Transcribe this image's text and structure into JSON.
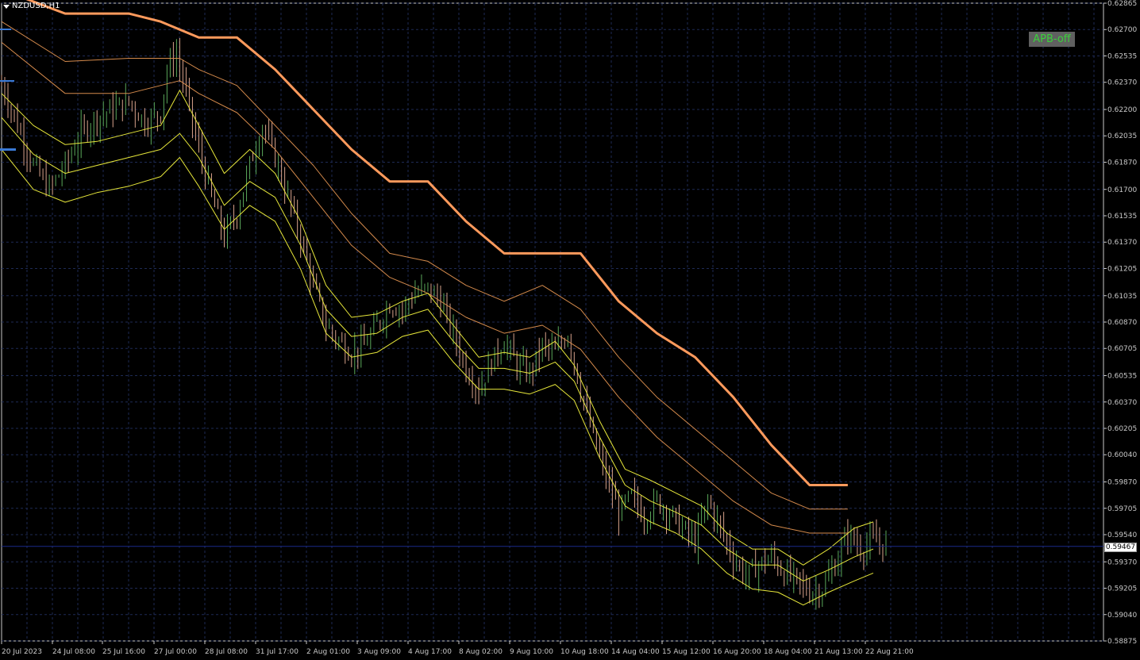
{
  "chart": {
    "symbol": "NZDUSD,H1",
    "button_label": "APB-off",
    "current_price": "0.59467"
  },
  "colors": {
    "background": "#000000",
    "grid": "#1e2a55",
    "axis": "#c8c8c8",
    "bull": "#5aa85a",
    "bear": "#d9a38c",
    "band_thick": "#ff9a5c",
    "band_thin": "#d48a4c",
    "ma_yellow": "#e6e63a",
    "bid_line": "#1a2a8a",
    "button_text": "#3ad13a"
  },
  "chart_data": {
    "type": "line",
    "title": "NZDUSD,H1",
    "ylim": [
      0.58875,
      0.62865
    ],
    "y_ticks": [
      "0.62865",
      "0.62700",
      "0.62535",
      "0.62370",
      "0.62200",
      "0.62035",
      "0.61870",
      "0.61700",
      "0.61535",
      "0.61370",
      "0.61205",
      "0.61035",
      "0.60870",
      "0.60705",
      "0.60535",
      "0.60370",
      "0.60205",
      "0.60040",
      "0.59870",
      "0.59705",
      "0.59540",
      "0.59370",
      "0.59205",
      "0.59040",
      "0.58875"
    ],
    "x_ticks": [
      "20 Jul 2023",
      "24 Jul 08:00",
      "25 Jul 16:00",
      "27 Jul 00:00",
      "28 Jul 08:00",
      "31 Jul 17:00",
      "2 Aug 01:00",
      "3 Aug 09:00",
      "4 Aug 17:00",
      "8 Aug 02:00",
      "9 Aug 10:00",
      "10 Aug 18:00",
      "14 Aug 04:00",
      "15 Aug 12:00",
      "16 Aug 20:00",
      "18 Aug 04:00",
      "21 Aug 13:00",
      "22 Aug 21:00"
    ],
    "grid": true,
    "price_close": [
      [
        0,
        0.6236
      ],
      [
        5,
        0.621
      ],
      [
        10,
        0.6185
      ],
      [
        15,
        0.617
      ],
      [
        20,
        0.6185
      ],
      [
        25,
        0.6205
      ],
      [
        30,
        0.6215
      ],
      [
        35,
        0.622
      ],
      [
        40,
        0.6225
      ],
      [
        45,
        0.6212
      ],
      [
        50,
        0.6218
      ],
      [
        52,
        0.6245
      ],
      [
        55,
        0.6255
      ],
      [
        58,
        0.623
      ],
      [
        62,
        0.6195
      ],
      [
        66,
        0.6165
      ],
      [
        70,
        0.614
      ],
      [
        74,
        0.6155
      ],
      [
        78,
        0.6185
      ],
      [
        82,
        0.621
      ],
      [
        86,
        0.619
      ],
      [
        90,
        0.6165
      ],
      [
        94,
        0.614
      ],
      [
        98,
        0.611
      ],
      [
        102,
        0.6085
      ],
      [
        106,
        0.6075
      ],
      [
        110,
        0.6068
      ],
      [
        114,
        0.6072
      ],
      [
        118,
        0.6085
      ],
      [
        122,
        0.6098
      ],
      [
        126,
        0.6095
      ],
      [
        130,
        0.6105
      ],
      [
        134,
        0.6108
      ],
      [
        138,
        0.61
      ],
      [
        142,
        0.608
      ],
      [
        146,
        0.6058
      ],
      [
        150,
        0.6045
      ],
      [
        154,
        0.6062
      ],
      [
        158,
        0.6075
      ],
      [
        162,
        0.606
      ],
      [
        166,
        0.6055
      ],
      [
        170,
        0.6072
      ],
      [
        174,
        0.6068
      ],
      [
        178,
        0.608
      ],
      [
        182,
        0.6045
      ],
      [
        186,
        0.6015
      ],
      [
        190,
        0.599
      ],
      [
        194,
        0.5968
      ],
      [
        198,
        0.5978
      ],
      [
        202,
        0.5965
      ],
      [
        206,
        0.5975
      ],
      [
        210,
        0.5968
      ],
      [
        214,
        0.5958
      ],
      [
        218,
        0.595
      ],
      [
        222,
        0.5975
      ],
      [
        226,
        0.5958
      ],
      [
        230,
        0.594
      ],
      [
        234,
        0.5928
      ],
      [
        238,
        0.5935
      ],
      [
        242,
        0.594
      ],
      [
        246,
        0.593
      ],
      [
        250,
        0.5925
      ],
      [
        254,
        0.5918
      ],
      [
        258,
        0.592
      ],
      [
        262,
        0.5935
      ],
      [
        266,
        0.5955
      ],
      [
        270,
        0.5945
      ],
      [
        274,
        0.595
      ],
      [
        278,
        0.5947
      ]
    ],
    "series": [
      {
        "name": "",
        "values": [
          [
            0,
            0.6295
          ],
          [
            20,
            0.628
          ],
          [
            40,
            0.628
          ],
          [
            50,
            0.6275
          ],
          [
            56,
            0.627
          ],
          [
            62,
            0.6265
          ],
          [
            74,
            0.6265
          ],
          [
            86,
            0.6245
          ],
          [
            98,
            0.622
          ],
          [
            110,
            0.6195
          ],
          [
            122,
            0.6175
          ],
          [
            134,
            0.6175
          ],
          [
            146,
            0.615
          ],
          [
            158,
            0.613
          ],
          [
            170,
            0.613
          ],
          [
            182,
            0.613
          ],
          [
            194,
            0.61
          ],
          [
            206,
            0.608
          ],
          [
            218,
            0.6065
          ],
          [
            230,
            0.604
          ],
          [
            242,
            0.601
          ],
          [
            254,
            0.5985
          ],
          [
            266,
            0.5985
          ]
        ]
      },
      {
        "name": "",
        "values": [
          [
            0,
            0.6275
          ],
          [
            20,
            0.625
          ],
          [
            40,
            0.6252
          ],
          [
            56,
            0.6252
          ],
          [
            62,
            0.6245
          ],
          [
            74,
            0.6235
          ],
          [
            86,
            0.621
          ],
          [
            98,
            0.6185
          ],
          [
            110,
            0.6155
          ],
          [
            122,
            0.613
          ],
          [
            134,
            0.6125
          ],
          [
            146,
            0.611
          ],
          [
            158,
            0.61
          ],
          [
            170,
            0.611
          ],
          [
            182,
            0.6095
          ],
          [
            194,
            0.6065
          ],
          [
            206,
            0.604
          ],
          [
            218,
            0.602
          ],
          [
            230,
            0.6
          ],
          [
            242,
            0.598
          ],
          [
            254,
            0.597
          ],
          [
            266,
            0.597
          ]
        ]
      },
      {
        "name": "",
        "values": [
          [
            0,
            0.6262
          ],
          [
            20,
            0.623
          ],
          [
            40,
            0.623
          ],
          [
            56,
            0.6238
          ],
          [
            62,
            0.623
          ],
          [
            74,
            0.6218
          ],
          [
            86,
            0.6195
          ],
          [
            98,
            0.6165
          ],
          [
            110,
            0.6135
          ],
          [
            122,
            0.6115
          ],
          [
            134,
            0.6105
          ],
          [
            146,
            0.609
          ],
          [
            158,
            0.608
          ],
          [
            170,
            0.6085
          ],
          [
            182,
            0.607
          ],
          [
            194,
            0.604
          ],
          [
            206,
            0.6015
          ],
          [
            218,
            0.5995
          ],
          [
            230,
            0.5975
          ],
          [
            242,
            0.596
          ],
          [
            254,
            0.5955
          ],
          [
            266,
            0.5955
          ]
        ]
      },
      {
        "name": "",
        "values": [
          [
            0,
            0.623
          ],
          [
            10,
            0.621
          ],
          [
            20,
            0.6198
          ],
          [
            30,
            0.62
          ],
          [
            40,
            0.6205
          ],
          [
            50,
            0.621
          ],
          [
            56,
            0.6232
          ],
          [
            62,
            0.621
          ],
          [
            70,
            0.618
          ],
          [
            78,
            0.6195
          ],
          [
            86,
            0.618
          ],
          [
            94,
            0.615
          ],
          [
            102,
            0.611
          ],
          [
            110,
            0.609
          ],
          [
            118,
            0.6092
          ],
          [
            126,
            0.61
          ],
          [
            134,
            0.6105
          ],
          [
            142,
            0.6085
          ],
          [
            150,
            0.6065
          ],
          [
            158,
            0.6068
          ],
          [
            166,
            0.6065
          ],
          [
            174,
            0.6075
          ],
          [
            180,
            0.606
          ],
          [
            188,
            0.6025
          ],
          [
            196,
            0.5995
          ],
          [
            204,
            0.5988
          ],
          [
            212,
            0.598
          ],
          [
            220,
            0.5972
          ],
          [
            228,
            0.5955
          ],
          [
            236,
            0.5945
          ],
          [
            244,
            0.5945
          ],
          [
            252,
            0.5935
          ],
          [
            260,
            0.5945
          ],
          [
            268,
            0.5958
          ],
          [
            274,
            0.5962
          ]
        ]
      },
      {
        "name": "",
        "values": [
          [
            0,
            0.6215
          ],
          [
            10,
            0.6192
          ],
          [
            20,
            0.618
          ],
          [
            30,
            0.6185
          ],
          [
            40,
            0.619
          ],
          [
            50,
            0.6195
          ],
          [
            56,
            0.6205
          ],
          [
            62,
            0.619
          ],
          [
            70,
            0.616
          ],
          [
            78,
            0.6175
          ],
          [
            86,
            0.6165
          ],
          [
            94,
            0.6135
          ],
          [
            102,
            0.6095
          ],
          [
            110,
            0.6078
          ],
          [
            118,
            0.608
          ],
          [
            126,
            0.609
          ],
          [
            134,
            0.6095
          ],
          [
            142,
            0.6075
          ],
          [
            150,
            0.6058
          ],
          [
            158,
            0.6058
          ],
          [
            166,
            0.6055
          ],
          [
            174,
            0.6062
          ],
          [
            180,
            0.605
          ],
          [
            188,
            0.6015
          ],
          [
            196,
            0.5985
          ],
          [
            204,
            0.5975
          ],
          [
            212,
            0.5968
          ],
          [
            220,
            0.596
          ],
          [
            228,
            0.5945
          ],
          [
            236,
            0.5935
          ],
          [
            244,
            0.5935
          ],
          [
            252,
            0.5925
          ],
          [
            260,
            0.5932
          ],
          [
            268,
            0.594
          ],
          [
            274,
            0.5945
          ]
        ]
      },
      {
        "name": "",
        "values": [
          [
            0,
            0.6195
          ],
          [
            10,
            0.617
          ],
          [
            20,
            0.6162
          ],
          [
            30,
            0.6168
          ],
          [
            40,
            0.6172
          ],
          [
            50,
            0.6178
          ],
          [
            56,
            0.619
          ],
          [
            62,
            0.6172
          ],
          [
            70,
            0.6145
          ],
          [
            78,
            0.616
          ],
          [
            86,
            0.615
          ],
          [
            94,
            0.612
          ],
          [
            102,
            0.608
          ],
          [
            110,
            0.6065
          ],
          [
            118,
            0.6068
          ],
          [
            126,
            0.6078
          ],
          [
            134,
            0.6082
          ],
          [
            142,
            0.6062
          ],
          [
            150,
            0.6045
          ],
          [
            158,
            0.6045
          ],
          [
            166,
            0.6042
          ],
          [
            174,
            0.6048
          ],
          [
            180,
            0.6038
          ],
          [
            188,
            0.6002
          ],
          [
            196,
            0.5972
          ],
          [
            204,
            0.5962
          ],
          [
            212,
            0.5955
          ],
          [
            220,
            0.5945
          ],
          [
            228,
            0.593
          ],
          [
            236,
            0.592
          ],
          [
            244,
            0.5918
          ],
          [
            252,
            0.591
          ],
          [
            260,
            0.5918
          ],
          [
            268,
            0.5925
          ],
          [
            274,
            0.593
          ]
        ]
      }
    ]
  }
}
